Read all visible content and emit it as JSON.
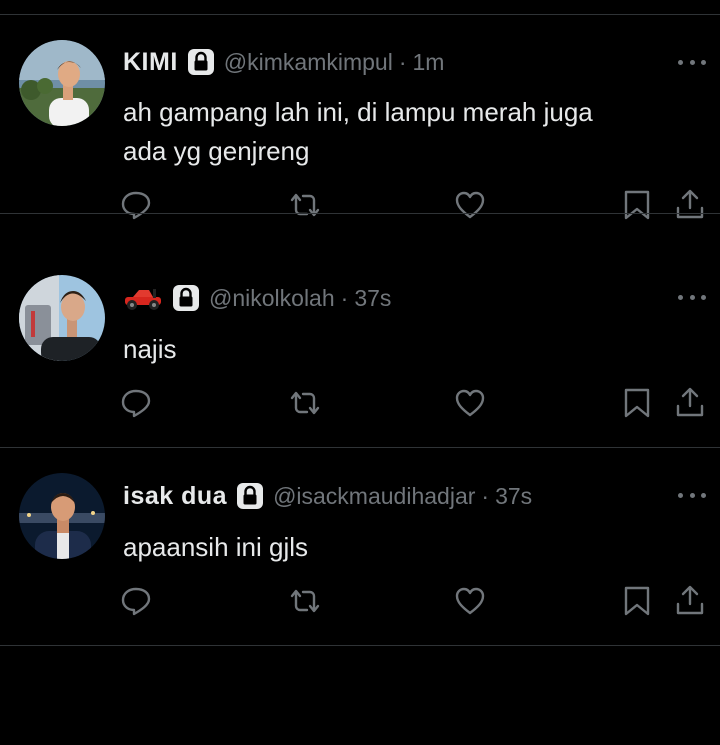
{
  "tweets": [
    {
      "name": "KIMI",
      "handle": "@kimkamkimpul",
      "dot": "·",
      "time": "1m",
      "text_lines": [
        "ah gampang lah ini, di lampu merah juga",
        "ada yg genjreng"
      ],
      "avatar": "avatar-photo-kimi",
      "name_icon": "",
      "protected": true
    },
    {
      "name": "",
      "handle": "@nikolkolah",
      "dot": "·",
      "time": "37s",
      "text_lines": [
        "najis"
      ],
      "avatar": "avatar-photo-nikol",
      "name_icon": "race-car-emoji",
      "protected": true
    },
    {
      "name": "isak dua",
      "handle": "@isackmaudihadjar",
      "dot": "·",
      "time": "37s",
      "text_lines": [
        "apaansih ini gjls"
      ],
      "avatar": "avatar-photo-isak",
      "name_icon": "",
      "protected": true
    }
  ],
  "action_icons": [
    "reply-icon",
    "retweet-icon",
    "like-icon",
    "bookmark-icon",
    "share-icon"
  ],
  "colors": {
    "background": "#000000",
    "text": "#e7e9ea",
    "muted": "#71767b",
    "divider": "#2f3336"
  }
}
